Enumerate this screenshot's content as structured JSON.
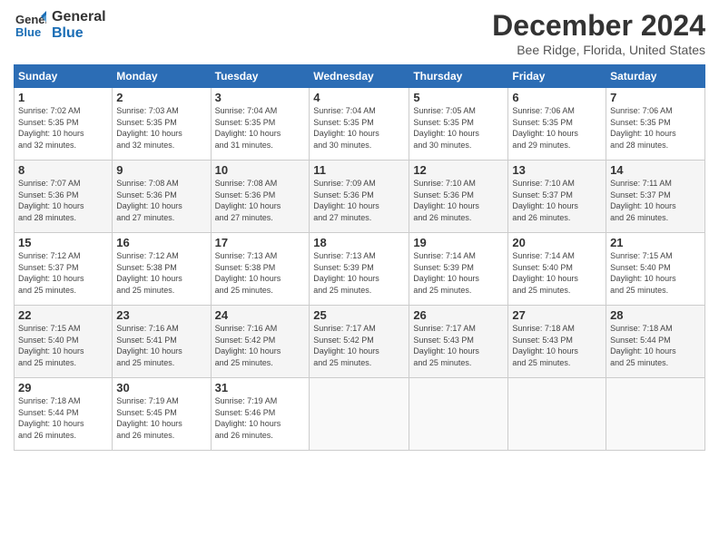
{
  "logo": {
    "line1": "General",
    "line2": "Blue"
  },
  "title": "December 2024",
  "subtitle": "Bee Ridge, Florida, United States",
  "days_of_week": [
    "Sunday",
    "Monday",
    "Tuesday",
    "Wednesday",
    "Thursday",
    "Friday",
    "Saturday"
  ],
  "weeks": [
    [
      {
        "day": "1",
        "info": "Sunrise: 7:02 AM\nSunset: 5:35 PM\nDaylight: 10 hours\nand 32 minutes."
      },
      {
        "day": "2",
        "info": "Sunrise: 7:03 AM\nSunset: 5:35 PM\nDaylight: 10 hours\nand 32 minutes."
      },
      {
        "day": "3",
        "info": "Sunrise: 7:04 AM\nSunset: 5:35 PM\nDaylight: 10 hours\nand 31 minutes."
      },
      {
        "day": "4",
        "info": "Sunrise: 7:04 AM\nSunset: 5:35 PM\nDaylight: 10 hours\nand 30 minutes."
      },
      {
        "day": "5",
        "info": "Sunrise: 7:05 AM\nSunset: 5:35 PM\nDaylight: 10 hours\nand 30 minutes."
      },
      {
        "day": "6",
        "info": "Sunrise: 7:06 AM\nSunset: 5:35 PM\nDaylight: 10 hours\nand 29 minutes."
      },
      {
        "day": "7",
        "info": "Sunrise: 7:06 AM\nSunset: 5:35 PM\nDaylight: 10 hours\nand 28 minutes."
      }
    ],
    [
      {
        "day": "8",
        "info": "Sunrise: 7:07 AM\nSunset: 5:36 PM\nDaylight: 10 hours\nand 28 minutes."
      },
      {
        "day": "9",
        "info": "Sunrise: 7:08 AM\nSunset: 5:36 PM\nDaylight: 10 hours\nand 27 minutes."
      },
      {
        "day": "10",
        "info": "Sunrise: 7:08 AM\nSunset: 5:36 PM\nDaylight: 10 hours\nand 27 minutes."
      },
      {
        "day": "11",
        "info": "Sunrise: 7:09 AM\nSunset: 5:36 PM\nDaylight: 10 hours\nand 27 minutes."
      },
      {
        "day": "12",
        "info": "Sunrise: 7:10 AM\nSunset: 5:36 PM\nDaylight: 10 hours\nand 26 minutes."
      },
      {
        "day": "13",
        "info": "Sunrise: 7:10 AM\nSunset: 5:37 PM\nDaylight: 10 hours\nand 26 minutes."
      },
      {
        "day": "14",
        "info": "Sunrise: 7:11 AM\nSunset: 5:37 PM\nDaylight: 10 hours\nand 26 minutes."
      }
    ],
    [
      {
        "day": "15",
        "info": "Sunrise: 7:12 AM\nSunset: 5:37 PM\nDaylight: 10 hours\nand 25 minutes."
      },
      {
        "day": "16",
        "info": "Sunrise: 7:12 AM\nSunset: 5:38 PM\nDaylight: 10 hours\nand 25 minutes."
      },
      {
        "day": "17",
        "info": "Sunrise: 7:13 AM\nSunset: 5:38 PM\nDaylight: 10 hours\nand 25 minutes."
      },
      {
        "day": "18",
        "info": "Sunrise: 7:13 AM\nSunset: 5:39 PM\nDaylight: 10 hours\nand 25 minutes."
      },
      {
        "day": "19",
        "info": "Sunrise: 7:14 AM\nSunset: 5:39 PM\nDaylight: 10 hours\nand 25 minutes."
      },
      {
        "day": "20",
        "info": "Sunrise: 7:14 AM\nSunset: 5:40 PM\nDaylight: 10 hours\nand 25 minutes."
      },
      {
        "day": "21",
        "info": "Sunrise: 7:15 AM\nSunset: 5:40 PM\nDaylight: 10 hours\nand 25 minutes."
      }
    ],
    [
      {
        "day": "22",
        "info": "Sunrise: 7:15 AM\nSunset: 5:40 PM\nDaylight: 10 hours\nand 25 minutes."
      },
      {
        "day": "23",
        "info": "Sunrise: 7:16 AM\nSunset: 5:41 PM\nDaylight: 10 hours\nand 25 minutes."
      },
      {
        "day": "24",
        "info": "Sunrise: 7:16 AM\nSunset: 5:42 PM\nDaylight: 10 hours\nand 25 minutes."
      },
      {
        "day": "25",
        "info": "Sunrise: 7:17 AM\nSunset: 5:42 PM\nDaylight: 10 hours\nand 25 minutes."
      },
      {
        "day": "26",
        "info": "Sunrise: 7:17 AM\nSunset: 5:43 PM\nDaylight: 10 hours\nand 25 minutes."
      },
      {
        "day": "27",
        "info": "Sunrise: 7:18 AM\nSunset: 5:43 PM\nDaylight: 10 hours\nand 25 minutes."
      },
      {
        "day": "28",
        "info": "Sunrise: 7:18 AM\nSunset: 5:44 PM\nDaylight: 10 hours\nand 25 minutes."
      }
    ],
    [
      {
        "day": "29",
        "info": "Sunrise: 7:18 AM\nSunset: 5:44 PM\nDaylight: 10 hours\nand 26 minutes."
      },
      {
        "day": "30",
        "info": "Sunrise: 7:19 AM\nSunset: 5:45 PM\nDaylight: 10 hours\nand 26 minutes."
      },
      {
        "day": "31",
        "info": "Sunrise: 7:19 AM\nSunset: 5:46 PM\nDaylight: 10 hours\nand 26 minutes."
      },
      {
        "day": "",
        "info": ""
      },
      {
        "day": "",
        "info": ""
      },
      {
        "day": "",
        "info": ""
      },
      {
        "day": "",
        "info": ""
      }
    ]
  ]
}
